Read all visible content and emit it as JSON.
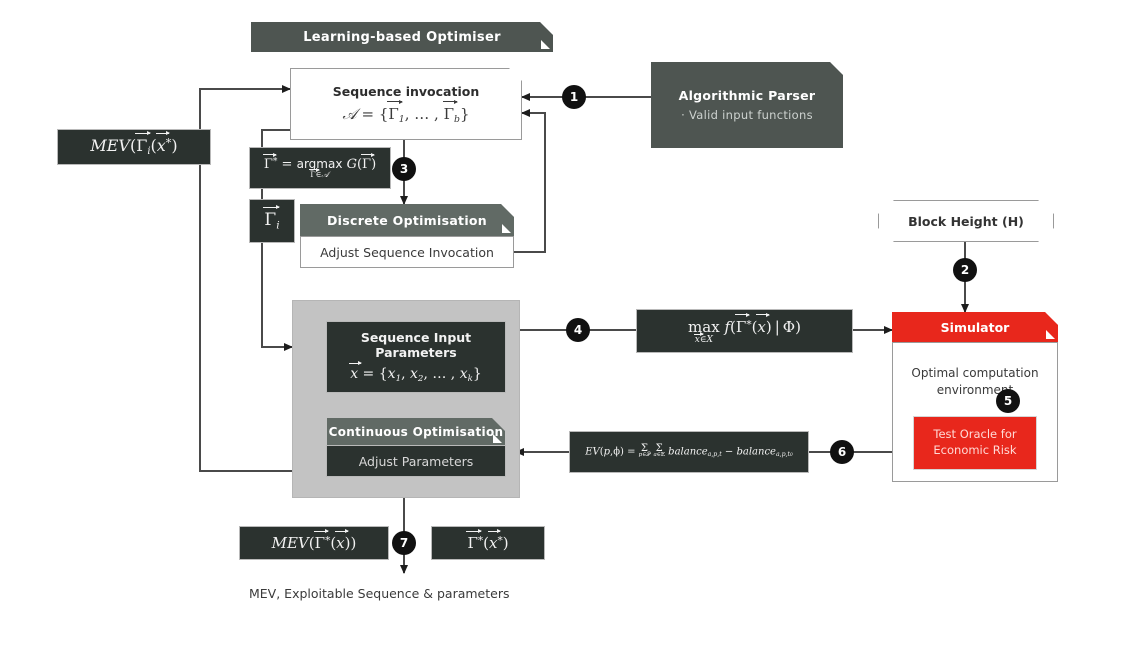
{
  "diagram": {
    "title": "Learning-based Optimiser framework",
    "colors": {
      "dark_slate": "#2b322f",
      "banner_gray": "#4e5551",
      "banner_gray_light": "#616a65",
      "group_gray": "#c3c3c3",
      "accent_red": "#e8271c",
      "wire": "#4a4a4a"
    },
    "nodes": {
      "learning_optimiser": {
        "label": "Learning-based Optimiser"
      },
      "sequence_invocation": {
        "title": "Sequence invocation",
        "formula": "A = {Γ1, ..., Γb}"
      },
      "algorithmic_parser": {
        "title": "Algorithmic Parser",
        "bullet": "Valid input functions"
      },
      "mev_gamma_i": {
        "formula": "MEV(Γi(x*))"
      },
      "argmax_box": {
        "formula": "Γ* = argmax G(Γ)",
        "subscript": "Γ ∈ A"
      },
      "gamma_i_tag": {
        "formula": "Γi"
      },
      "discrete_optimisation": {
        "title": "Discrete Optimisation",
        "body": "Adjust Sequence Invocation"
      },
      "sequence_input_parameters": {
        "title": "Sequence Input Parameters",
        "formula": "x = {x1, x2, ..., xk}"
      },
      "continuous_optimisation": {
        "title": "Continuous Optimisation",
        "body": "Adjust Parameters"
      },
      "max_f_box": {
        "formula": "max f(Γ*(x) | Φ)",
        "subscript": "x ∈ X"
      },
      "block_height": {
        "label": "Block Height (H)"
      },
      "simulator": {
        "title": "Simulator",
        "body": "Optimal computation environment",
        "oracle": "Test Oracle for Economic Risk"
      },
      "ev_formula": {
        "formula": "EV(p, φ) = Σ Σ balance a,p,t − balance a,p,t0"
      },
      "mev_gamma_star": {
        "formula": "MEV(Γ*(x))"
      },
      "gamma_star_x_star": {
        "formula": "Γ*(x*)"
      },
      "output_caption": {
        "text": "MEV, Exploitable Sequence & parameters"
      }
    },
    "steps": [
      {
        "id": "1",
        "label": "1"
      },
      {
        "id": "2",
        "label": "2"
      },
      {
        "id": "3",
        "label": "3"
      },
      {
        "id": "4",
        "label": "4"
      },
      {
        "id": "5",
        "label": "5"
      },
      {
        "id": "6",
        "label": "6"
      },
      {
        "id": "7",
        "label": "7"
      }
    ]
  }
}
